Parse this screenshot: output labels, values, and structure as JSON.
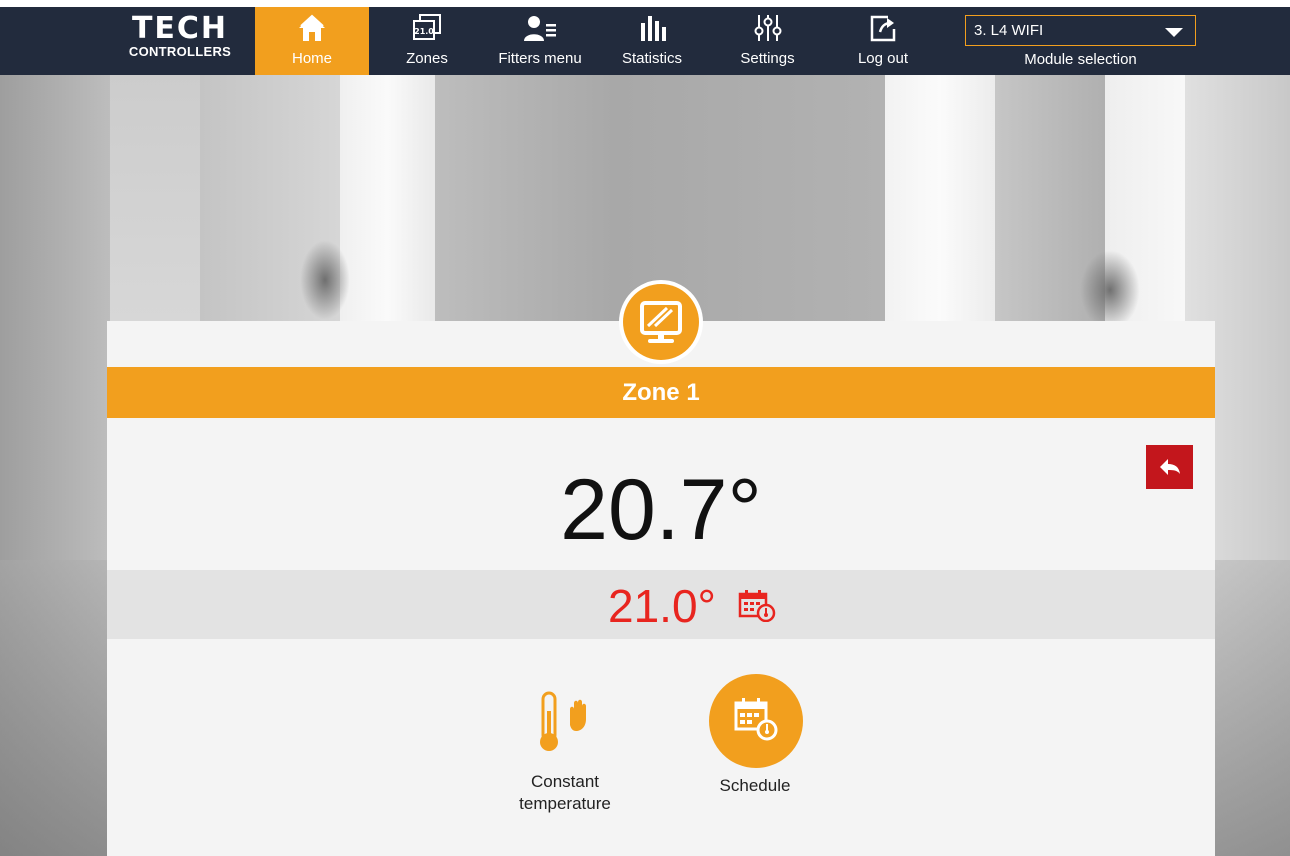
{
  "brand": {
    "line1": "TECH",
    "line2": "CONTROLLERS"
  },
  "nav": {
    "items": [
      {
        "label": "Home",
        "icon": "home-icon",
        "active": true
      },
      {
        "label": "Zones",
        "icon": "zones-icon",
        "badge": "21.0"
      },
      {
        "label": "Fitters menu",
        "icon": "fitters-menu-icon"
      },
      {
        "label": "Statistics",
        "icon": "statistics-icon"
      },
      {
        "label": "Settings",
        "icon": "settings-icon"
      },
      {
        "label": "Log out",
        "icon": "logout-icon"
      }
    ]
  },
  "module": {
    "value": "3. L4 WIFI",
    "label": "Module selection"
  },
  "zone": {
    "title": "Zone 1",
    "current_temp": "20.7°",
    "set_temp": "21.0°"
  },
  "modes": {
    "constant": {
      "label_line1": "Constant",
      "label_line2": "temperature"
    },
    "schedule": {
      "label": "Schedule"
    }
  },
  "colors": {
    "accent": "#f29f1e",
    "nav_bg": "#222b3d",
    "set_temp": "#e8251f",
    "back_button": "#c3161c"
  }
}
